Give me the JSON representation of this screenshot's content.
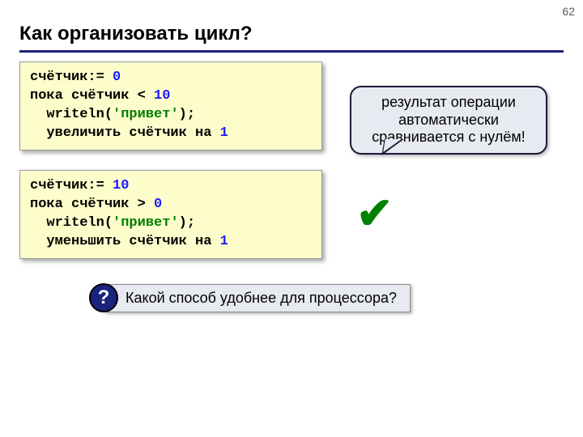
{
  "page_number": "62",
  "title": "Как организовать цикл?",
  "code1": {
    "line1_a": "счётчик:= ",
    "line1_b": "0",
    "line2_a": "пока счётчик < ",
    "line2_b": "10",
    "line3_a": "  writeln(",
    "line3_b": "'привет'",
    "line3_c": ");",
    "line4_a": "  увеличить счётчик на ",
    "line4_b": "1"
  },
  "code2": {
    "line1_a": "счётчик:= ",
    "line1_b": "10",
    "line2_a": "пока счётчик > ",
    "line2_b": "0",
    "line3_a": "  writeln(",
    "line3_b": "'привет'",
    "line3_c": ");",
    "line4_a": "  уменьшить счётчик на ",
    "line4_b": "1"
  },
  "callout_l1": "результат операции",
  "callout_l2": "автоматически",
  "callout_l3": "сравнивается с нулём!",
  "checkmark": "✔",
  "question_mark": "?",
  "question_text": "Какой способ удобнее для процессора?"
}
